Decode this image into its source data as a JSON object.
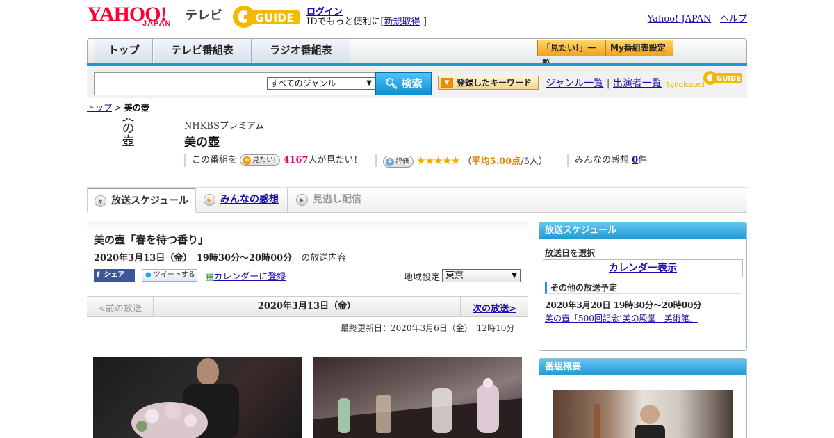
{
  "header": {
    "yahoo_logo": "YAHOO!",
    "japan_logo": "JAPAN",
    "tv_label": "テレビ",
    "gguide_logo": "GUIDE",
    "login_link": "ログイン",
    "login_prefix": "IDでもっと便利に[",
    "signup_link": "新規取得",
    "login_suffix": "]",
    "yahoo_japan_link": "Yahoo! JAPAN",
    "separator": "-",
    "help_link": "ヘルプ"
  },
  "nav": {
    "tabs": [
      {
        "label": "トップ"
      },
      {
        "label": "テレビ番組表"
      },
      {
        "label": "ラジオ番組表"
      }
    ],
    "mitai_list": "「見たい!」一覧",
    "my_schedule": "My番組表設定"
  },
  "search": {
    "input_value": "",
    "genre_selected": "すべてのジャンル",
    "search_button": "検索",
    "keyword_button": "登録したキーワード",
    "genre_list_link": "ジャンル一覧",
    "pipe": "|",
    "performer_list_link": "出演者一覧",
    "syndicated": "Syndicated",
    "gguide_small": "GUIDE"
  },
  "breadcrumb": {
    "top": "トップ",
    "sep": ">",
    "current": "美の壺"
  },
  "program": {
    "logo_text": "美の壺",
    "channel": "NHKBSプレミアム",
    "title": "美の壺",
    "mitai_prefix": "この番組を",
    "mitai_button": "見たい!",
    "mitai_count": "4167",
    "mitai_suffix": "人が見たい！",
    "rate_button": "評価",
    "stars": "★★★★★",
    "rating_open": "（",
    "rating_avg": "平均5.00点",
    "rating_count": "/5人）",
    "kanso_label": "みんなの感想",
    "kanso_count": "0",
    "kanso_unit": "件"
  },
  "subtabs": {
    "schedule": "放送スケジュール",
    "kanso": "みんなの感想",
    "minogashi": "見逃し配信"
  },
  "episode": {
    "title": "美の壺「春を待つ香り」",
    "datetime": "2020年3月13日（金）　19時30分～20時00分",
    "datetime_suffix": "の放送内容",
    "share_fb": "シェア",
    "share_tw": "ツイートする",
    "calendar_register": "カレンダーに登録",
    "region_label": "地域設定",
    "region_value": "東京"
  },
  "pager": {
    "prev": "<前の放送",
    "current": "2020年3月13日（金）",
    "next": "次の放送>"
  },
  "updated": "最終更新日：2020年3月6日（金）　12時10分",
  "sidebar": {
    "schedule_head": "放送スケジュール",
    "select_day": "放送日を選択",
    "calendar_button": "カレンダー表示",
    "other_head": "その他の放送予定",
    "other_time": "2020年3月20日 19時30分～20時00分",
    "other_link": "美の壺「500回記念!美の殿堂　美術館」",
    "summary_head": "番組概要"
  },
  "colors": {
    "accent_blue": "#1a9ad6",
    "yahoo_red": "#ff0033",
    "pink": "#e4007f",
    "star_gold": "#f2a900"
  }
}
